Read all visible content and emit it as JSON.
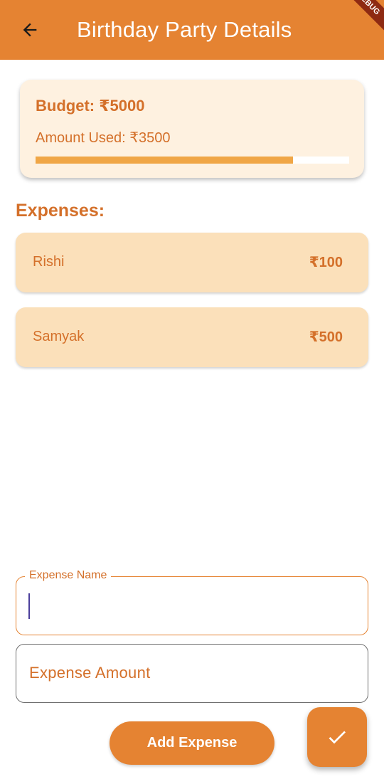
{
  "appbar": {
    "title": "Birthday Party Details",
    "back_icon": "arrow-left-icon",
    "debug_banner": "DEBUG",
    "color": "#E58332"
  },
  "budget": {
    "label": "Budget: ₹5000",
    "amount_used_label": "Amount Used: ₹3500",
    "progress_fraction": 0.82
  },
  "expenses": {
    "heading": "Expenses:",
    "items": [
      {
        "name": "Rishi",
        "amount": "₹100"
      },
      {
        "name": "Samyak",
        "amount": "₹500"
      }
    ]
  },
  "form": {
    "name_field": {
      "label": "Expense Name",
      "value": ""
    },
    "amount_field": {
      "placeholder": "Expense Amount",
      "value": ""
    },
    "submit_label": "Add Expense",
    "fab_icon": "check-icon"
  }
}
